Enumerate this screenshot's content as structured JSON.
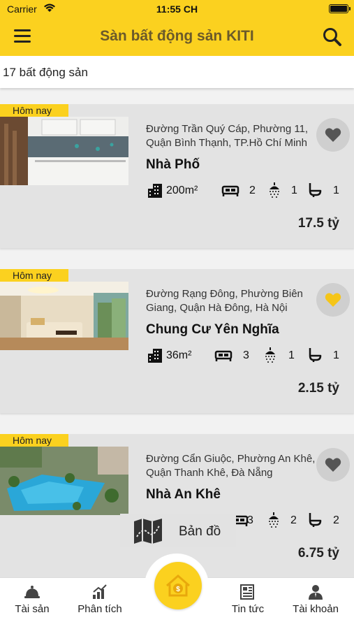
{
  "status": {
    "carrier": "Carrier",
    "time": "11:55 CH"
  },
  "header": {
    "title": "Sàn bất động sản KITI"
  },
  "summary": {
    "count_label": "17 bất động sản"
  },
  "listings": [
    {
      "badge": "Hôm nay",
      "address_line1": "Đường Trần Quý Cáp, Phường 11,",
      "address_line2": "Quận Bình Thạnh, TP.Hồ Chí Minh",
      "name": "Nhà Phố",
      "area": "200m²",
      "bedrooms": "2",
      "showers": "1",
      "toilets": "1",
      "price": "17.5 tỷ",
      "favorite": false
    },
    {
      "badge": "Hôm nay",
      "address_line1": "Đường Rạng Đông, Phường Biên",
      "address_line2": "Giang, Quận Hà Đông, Hà Nội",
      "name": "Chung Cư Yên Nghĩa",
      "area": "36m²",
      "bedrooms": "3",
      "showers": "1",
      "toilets": "1",
      "price": "2.15 tỷ",
      "favorite": true
    },
    {
      "badge": "Hôm nay",
      "address_line1": "Đường Cẩn Giuộc, Phường An Khê,",
      "address_line2": "Quận Thanh Khê, Đà Nẵng",
      "name": "Nhà An Khê",
      "area": "",
      "bedrooms": "3",
      "showers": "2",
      "toilets": "2",
      "price": "6.75 tỷ",
      "favorite": false
    }
  ],
  "map_button": {
    "label": "Bản đồ"
  },
  "tabs": [
    {
      "label": "Tài sản",
      "icon": "property-bell-icon"
    },
    {
      "label": "Phân tích",
      "icon": "analytics-chart-icon"
    },
    {
      "label": "Tin tức",
      "icon": "news-icon"
    },
    {
      "label": "Tài khoản",
      "icon": "account-icon"
    }
  ],
  "colors": {
    "accent": "#fbd11f",
    "favorite_active": "#f5c518",
    "card_bg": "#e3e3e3"
  }
}
